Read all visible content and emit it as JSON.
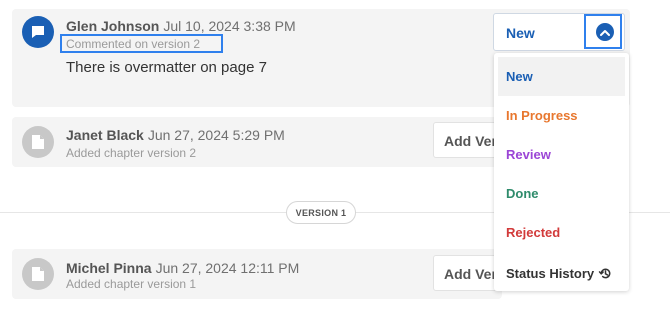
{
  "comment": {
    "author": "Glen Johnson",
    "date": "Jul 10, 2024 3:38 PM",
    "version_note": "Commented on version 2",
    "text": "There is overmatter on page 7"
  },
  "status": {
    "selected": "New",
    "options": [
      {
        "label": "New",
        "color": "#1a5fb4"
      },
      {
        "label": "In Progress",
        "color": "#e8772e"
      },
      {
        "label": "Review",
        "color": "#9b45d6"
      },
      {
        "label": "Done",
        "color": "#2e8b6b"
      },
      {
        "label": "Rejected",
        "color": "#d23a3a"
      }
    ],
    "history_label": "Status History"
  },
  "events": [
    {
      "author": "Janet Black",
      "date": "Jun 27, 2024 5:29 PM",
      "note": "Added chapter version 2",
      "button": "Add Version"
    },
    {
      "author": "Michel Pinna",
      "date": "Jun 27, 2024 12:11 PM",
      "note": "Added chapter version 1",
      "button": "Add Version"
    }
  ],
  "divider": {
    "label": "VERSION 1"
  },
  "colors": {
    "accent": "#1a5fb4",
    "highlight": "#2f80ed"
  }
}
